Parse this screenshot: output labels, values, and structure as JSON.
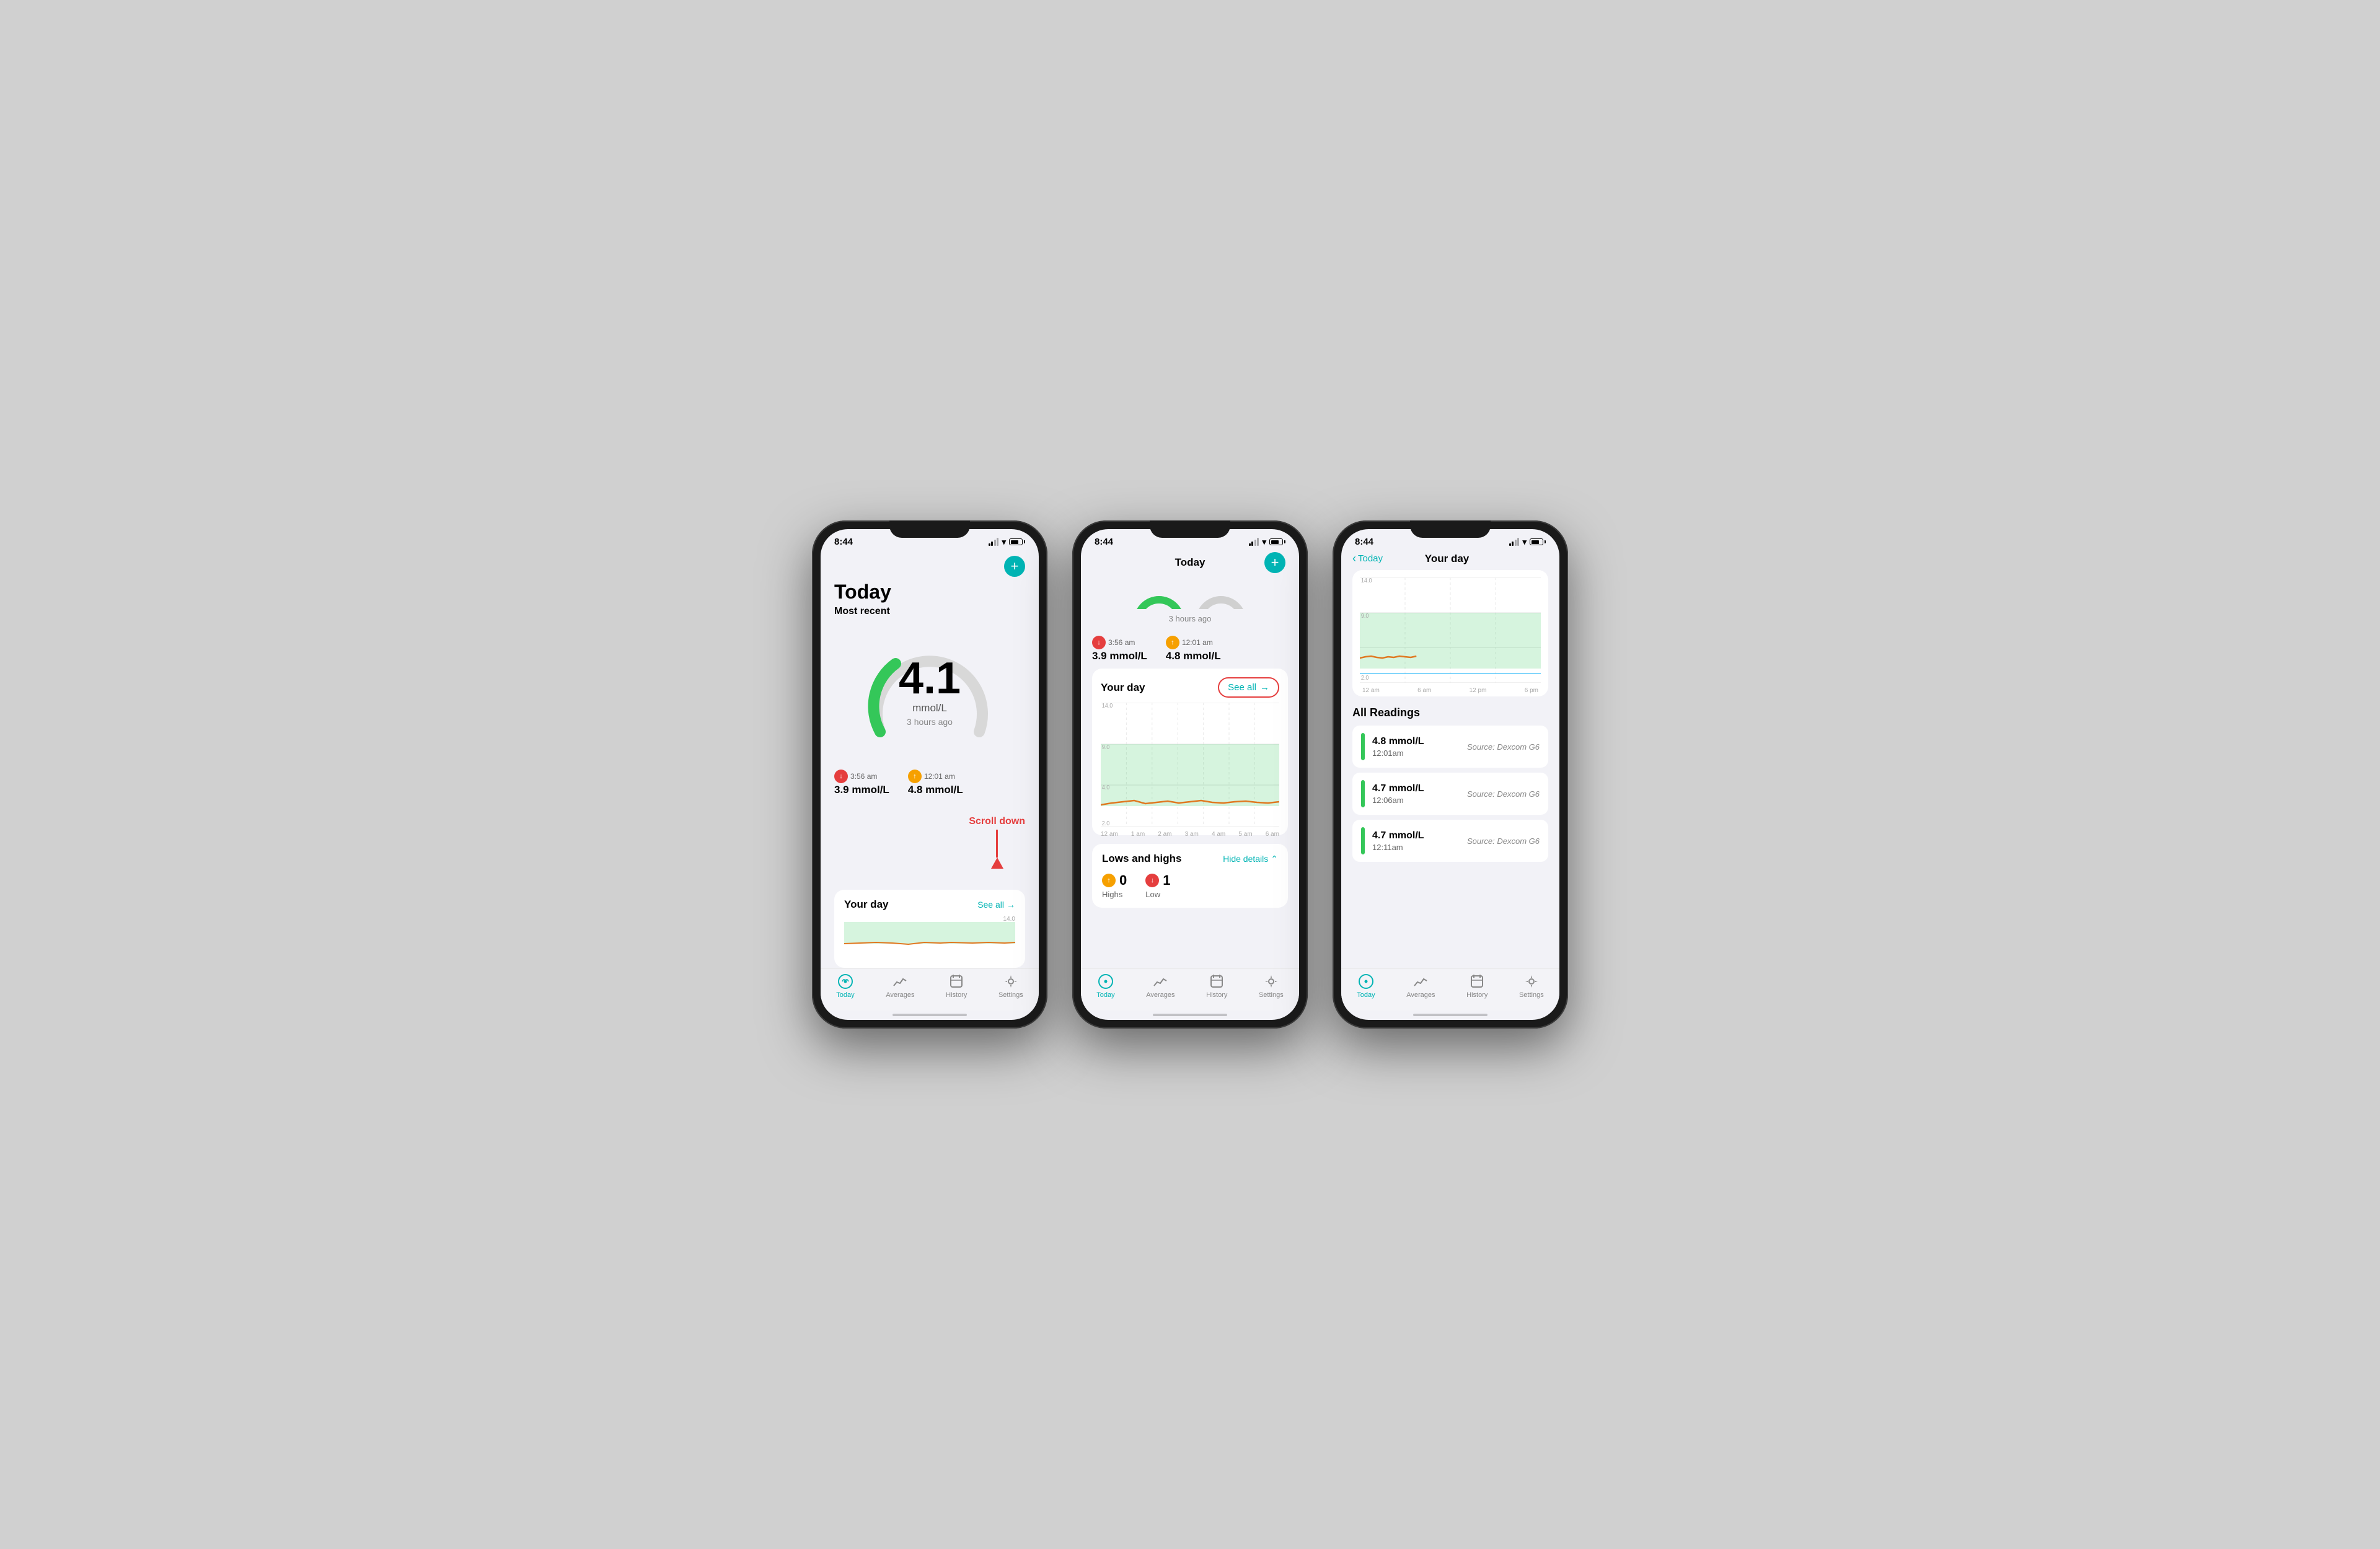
{
  "phones": [
    {
      "id": "phone1",
      "status_time": "8:44",
      "screen_title": "Today",
      "screen_subtitle": "Most recent",
      "gauge_value": "4.1",
      "gauge_unit": "mmol/L",
      "gauge_time": "3 hours ago",
      "low_reading": {
        "time": "3:56 am",
        "value": "3.9 mmol/L",
        "direction": "down",
        "type": "red"
      },
      "high_reading": {
        "time": "12:01 am",
        "value": "4.8 mmol/L",
        "direction": "up",
        "type": "yellow"
      },
      "scroll_annotation": "Scroll down",
      "your_day_label": "Your day",
      "see_all_label": "See all",
      "chart_max_label": "14.0",
      "nav": {
        "items": [
          {
            "label": "Today",
            "active": true
          },
          {
            "label": "Averages",
            "active": false
          },
          {
            "label": "History",
            "active": false
          },
          {
            "label": "Settings",
            "active": false
          }
        ]
      }
    },
    {
      "id": "phone2",
      "status_time": "8:44",
      "screen_title": "Today",
      "time_ago": "3 hours ago",
      "low_reading": {
        "time": "3:56 am",
        "value": "3.9 mmol/L",
        "direction": "down",
        "type": "red"
      },
      "high_reading": {
        "time": "12:01 am",
        "value": "4.8 mmol/L",
        "direction": "up",
        "type": "yellow"
      },
      "your_day_label": "Your day",
      "see_all_label": "See all",
      "chart": {
        "max": "14.0",
        "min": "2.0",
        "mid": "9.0",
        "low_target": "4.0",
        "x_labels": [
          "12 am",
          "1 am",
          "2 am",
          "3 am",
          "4 am",
          "5 am",
          "6 am"
        ]
      },
      "lows_highs": {
        "title": "Lows and highs",
        "hide_details_label": "Hide details",
        "highs_count": "0",
        "highs_label": "Highs",
        "lows_count": "1",
        "lows_label": "Low"
      },
      "nav": {
        "items": [
          {
            "label": "Today",
            "active": true
          },
          {
            "label": "Averages",
            "active": false
          },
          {
            "label": "History",
            "active": false
          },
          {
            "label": "Settings",
            "active": false
          }
        ]
      }
    },
    {
      "id": "phone3",
      "status_time": "8:44",
      "back_label": "Today",
      "screen_title": "Your day",
      "chart": {
        "max": "14.0",
        "y_labels": [
          "14.0",
          "9.0",
          "2.0"
        ],
        "x_labels": [
          "12 am",
          "6 am",
          "12 pm",
          "6 pm"
        ]
      },
      "all_readings_title": "All Readings",
      "readings": [
        {
          "value": "4.8 mmol/L",
          "time": "12:01am",
          "source": "Source: Dexcom G6"
        },
        {
          "value": "4.7 mmol/L",
          "time": "12:06am",
          "source": "Source: Dexcom G6"
        },
        {
          "value": "4.7 mmol/L",
          "time": "12:11am",
          "source": "Source: Dexcom G6"
        }
      ],
      "nav": {
        "items": [
          {
            "label": "Today",
            "active": true
          },
          {
            "label": "Averages",
            "active": false
          },
          {
            "label": "History",
            "active": false
          },
          {
            "label": "Settings",
            "active": false
          }
        ]
      }
    }
  ],
  "colors": {
    "teal": "#00b4b4",
    "red": "#e53e3e",
    "yellow": "#f6a000",
    "green": "#34c759",
    "orange": "#e07820",
    "light_green_area": "rgba(52,199,89,0.25)"
  }
}
